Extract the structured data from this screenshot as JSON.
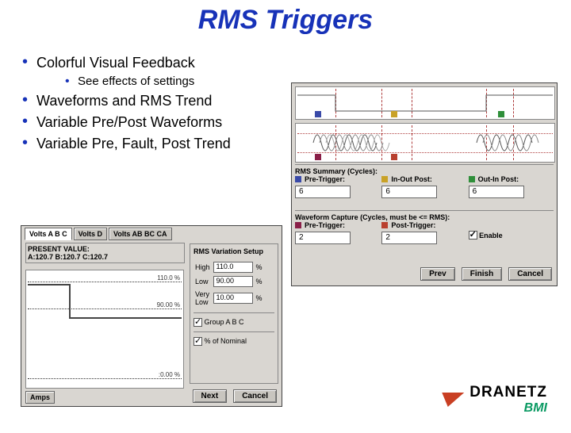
{
  "title": "RMS Triggers",
  "outline": {
    "b1": "Colorful Visual Feedback",
    "b1s1": "See effects of settings",
    "b2": "Waveforms and RMS Trend",
    "b3": "Variable Pre/Post Waveforms",
    "b4": "Variable Pre, Fault, Post Trend"
  },
  "right": {
    "rms_summary_title": "RMS Summary (Cycles):",
    "labels": {
      "pre_trigger": "Pre-Trigger:",
      "in_out_post": "In-Out Post:",
      "out_in_post": "Out-In Post:"
    },
    "values": {
      "pre_trigger": "6",
      "in_out_post": "6",
      "out_in_post": "6"
    },
    "wave_title": "Waveform Capture (Cycles, must be <= RMS):",
    "wave_labels": {
      "pre": "Pre-Trigger:",
      "post": "Post-Trigger:",
      "enable": "Enable"
    },
    "wave_values": {
      "pre": "2",
      "post": "2"
    },
    "buttons": {
      "prev": "Prev",
      "finish": "Finish",
      "cancel": "Cancel"
    },
    "colors": {
      "pre": "#3a4aa8",
      "inout": "#c9a227",
      "outin": "#2f8f3a",
      "wpre": "#8a1f48",
      "wpost": "#b9402f"
    }
  },
  "left": {
    "tabs": {
      "abc": "Volts A B C",
      "d": "Volts D",
      "line": "Volts AB BC CA"
    },
    "present_header": "PRESENT VALUE:",
    "present_values": "A:120.7  B:120.7  C:120.7",
    "chart_labels": {
      "high": "110.0 %",
      "low": "90.00 %",
      "vlow": ":0.00 %"
    },
    "btn_high": "High",
    "btn_low": "Low",
    "btn_vlow": "Very Low",
    "amps_tab": "Amps",
    "setup": {
      "title": "RMS Variation Setup",
      "rows": {
        "high": {
          "lbl": "High",
          "val": "110.0",
          "unit": "%"
        },
        "low": {
          "lbl": "Low",
          "val": "90.00",
          "unit": "%"
        },
        "vlow_lbl1": "Very",
        "vlow_lbl2": "Low",
        "vlow_val": "10.00",
        "vlow_unit": "%"
      },
      "group": "Group A B C",
      "nominal": "% of Nominal"
    },
    "buttons": {
      "next": "Next",
      "cancel": "Cancel"
    }
  },
  "logo": {
    "name": "DRANETZ",
    "sub": "BMI"
  }
}
